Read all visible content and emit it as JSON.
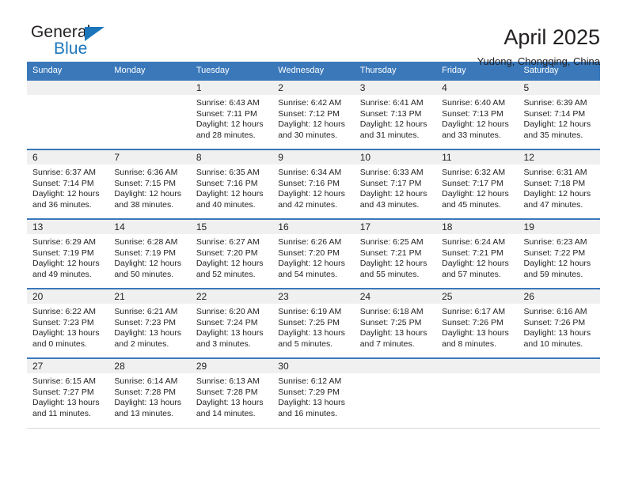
{
  "brand": {
    "name_part1": "General",
    "name_part2": "Blue",
    "accent_color": "#1b75bb"
  },
  "header": {
    "title": "April 2025",
    "subtitle": "Yudong, Chongqing, China"
  },
  "theme": {
    "header_row_color": "#3a78ba",
    "daynum_band_color": "#f0f0f0",
    "text_color": "#231f20"
  },
  "weekday_headers": [
    "Sunday",
    "Monday",
    "Tuesday",
    "Wednesday",
    "Thursday",
    "Friday",
    "Saturday"
  ],
  "weeks": [
    [
      {
        "day": "",
        "lines": []
      },
      {
        "day": "",
        "lines": []
      },
      {
        "day": "1",
        "lines": [
          "Sunrise: 6:43 AM",
          "Sunset: 7:11 PM",
          "Daylight: 12 hours",
          "and 28 minutes."
        ]
      },
      {
        "day": "2",
        "lines": [
          "Sunrise: 6:42 AM",
          "Sunset: 7:12 PM",
          "Daylight: 12 hours",
          "and 30 minutes."
        ]
      },
      {
        "day": "3",
        "lines": [
          "Sunrise: 6:41 AM",
          "Sunset: 7:13 PM",
          "Daylight: 12 hours",
          "and 31 minutes."
        ]
      },
      {
        "day": "4",
        "lines": [
          "Sunrise: 6:40 AM",
          "Sunset: 7:13 PM",
          "Daylight: 12 hours",
          "and 33 minutes."
        ]
      },
      {
        "day": "5",
        "lines": [
          "Sunrise: 6:39 AM",
          "Sunset: 7:14 PM",
          "Daylight: 12 hours",
          "and 35 minutes."
        ]
      }
    ],
    [
      {
        "day": "6",
        "lines": [
          "Sunrise: 6:37 AM",
          "Sunset: 7:14 PM",
          "Daylight: 12 hours",
          "and 36 minutes."
        ]
      },
      {
        "day": "7",
        "lines": [
          "Sunrise: 6:36 AM",
          "Sunset: 7:15 PM",
          "Daylight: 12 hours",
          "and 38 minutes."
        ]
      },
      {
        "day": "8",
        "lines": [
          "Sunrise: 6:35 AM",
          "Sunset: 7:16 PM",
          "Daylight: 12 hours",
          "and 40 minutes."
        ]
      },
      {
        "day": "9",
        "lines": [
          "Sunrise: 6:34 AM",
          "Sunset: 7:16 PM",
          "Daylight: 12 hours",
          "and 42 minutes."
        ]
      },
      {
        "day": "10",
        "lines": [
          "Sunrise: 6:33 AM",
          "Sunset: 7:17 PM",
          "Daylight: 12 hours",
          "and 43 minutes."
        ]
      },
      {
        "day": "11",
        "lines": [
          "Sunrise: 6:32 AM",
          "Sunset: 7:17 PM",
          "Daylight: 12 hours",
          "and 45 minutes."
        ]
      },
      {
        "day": "12",
        "lines": [
          "Sunrise: 6:31 AM",
          "Sunset: 7:18 PM",
          "Daylight: 12 hours",
          "and 47 minutes."
        ]
      }
    ],
    [
      {
        "day": "13",
        "lines": [
          "Sunrise: 6:29 AM",
          "Sunset: 7:19 PM",
          "Daylight: 12 hours",
          "and 49 minutes."
        ]
      },
      {
        "day": "14",
        "lines": [
          "Sunrise: 6:28 AM",
          "Sunset: 7:19 PM",
          "Daylight: 12 hours",
          "and 50 minutes."
        ]
      },
      {
        "day": "15",
        "lines": [
          "Sunrise: 6:27 AM",
          "Sunset: 7:20 PM",
          "Daylight: 12 hours",
          "and 52 minutes."
        ]
      },
      {
        "day": "16",
        "lines": [
          "Sunrise: 6:26 AM",
          "Sunset: 7:20 PM",
          "Daylight: 12 hours",
          "and 54 minutes."
        ]
      },
      {
        "day": "17",
        "lines": [
          "Sunrise: 6:25 AM",
          "Sunset: 7:21 PM",
          "Daylight: 12 hours",
          "and 55 minutes."
        ]
      },
      {
        "day": "18",
        "lines": [
          "Sunrise: 6:24 AM",
          "Sunset: 7:21 PM",
          "Daylight: 12 hours",
          "and 57 minutes."
        ]
      },
      {
        "day": "19",
        "lines": [
          "Sunrise: 6:23 AM",
          "Sunset: 7:22 PM",
          "Daylight: 12 hours",
          "and 59 minutes."
        ]
      }
    ],
    [
      {
        "day": "20",
        "lines": [
          "Sunrise: 6:22 AM",
          "Sunset: 7:23 PM",
          "Daylight: 13 hours",
          "and 0 minutes."
        ]
      },
      {
        "day": "21",
        "lines": [
          "Sunrise: 6:21 AM",
          "Sunset: 7:23 PM",
          "Daylight: 13 hours",
          "and 2 minutes."
        ]
      },
      {
        "day": "22",
        "lines": [
          "Sunrise: 6:20 AM",
          "Sunset: 7:24 PM",
          "Daylight: 13 hours",
          "and 3 minutes."
        ]
      },
      {
        "day": "23",
        "lines": [
          "Sunrise: 6:19 AM",
          "Sunset: 7:25 PM",
          "Daylight: 13 hours",
          "and 5 minutes."
        ]
      },
      {
        "day": "24",
        "lines": [
          "Sunrise: 6:18 AM",
          "Sunset: 7:25 PM",
          "Daylight: 13 hours",
          "and 7 minutes."
        ]
      },
      {
        "day": "25",
        "lines": [
          "Sunrise: 6:17 AM",
          "Sunset: 7:26 PM",
          "Daylight: 13 hours",
          "and 8 minutes."
        ]
      },
      {
        "day": "26",
        "lines": [
          "Sunrise: 6:16 AM",
          "Sunset: 7:26 PM",
          "Daylight: 13 hours",
          "and 10 minutes."
        ]
      }
    ],
    [
      {
        "day": "27",
        "lines": [
          "Sunrise: 6:15 AM",
          "Sunset: 7:27 PM",
          "Daylight: 13 hours",
          "and 11 minutes."
        ]
      },
      {
        "day": "28",
        "lines": [
          "Sunrise: 6:14 AM",
          "Sunset: 7:28 PM",
          "Daylight: 13 hours",
          "and 13 minutes."
        ]
      },
      {
        "day": "29",
        "lines": [
          "Sunrise: 6:13 AM",
          "Sunset: 7:28 PM",
          "Daylight: 13 hours",
          "and 14 minutes."
        ]
      },
      {
        "day": "30",
        "lines": [
          "Sunrise: 6:12 AM",
          "Sunset: 7:29 PM",
          "Daylight: 13 hours",
          "and 16 minutes."
        ]
      },
      {
        "day": "",
        "lines": []
      },
      {
        "day": "",
        "lines": []
      },
      {
        "day": "",
        "lines": []
      }
    ]
  ]
}
